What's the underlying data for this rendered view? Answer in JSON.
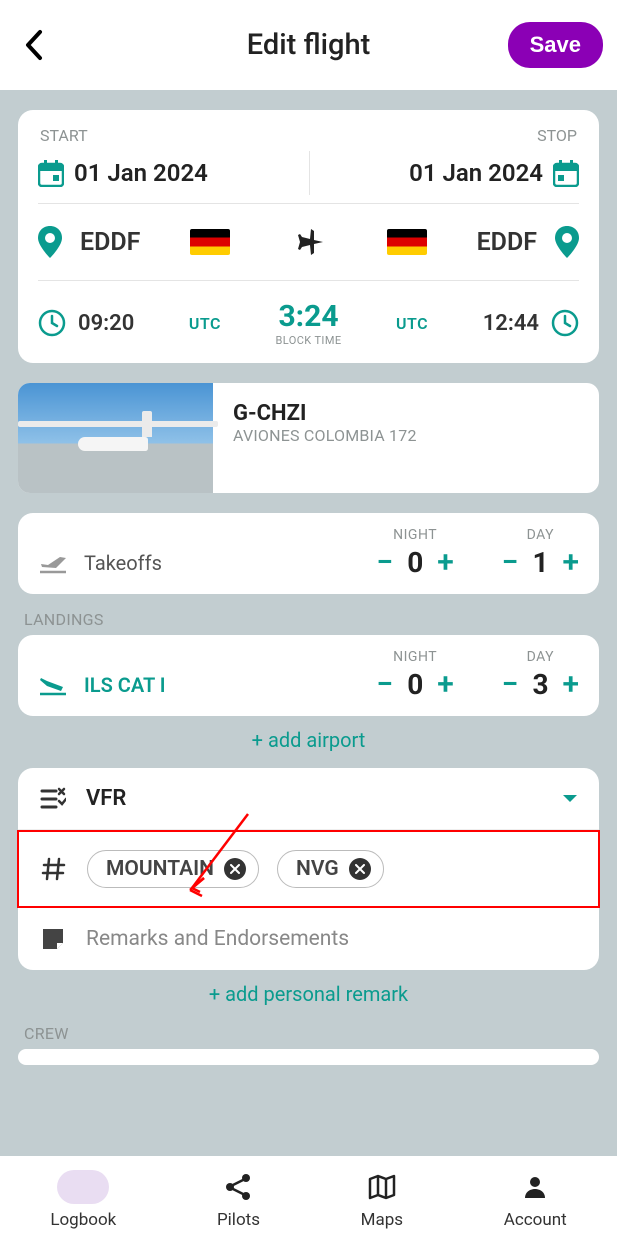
{
  "header": {
    "title": "Edit flight",
    "save": "Save"
  },
  "route": {
    "start_label": "START",
    "stop_label": "STOP",
    "start_date": "01 Jan 2024",
    "stop_date": "01 Jan 2024",
    "dep_code": "EDDF",
    "arr_code": "EDDF",
    "dep_time": "09:20",
    "arr_time": "12:44",
    "tz_left": "UTC",
    "tz_right": "UTC",
    "block_value": "3:24",
    "block_label": "BLOCK TIME"
  },
  "aircraft": {
    "reg": "G-CHZI",
    "type": "AVIONES COLOMBIA 172"
  },
  "takeoffs": {
    "label": "Takeoffs",
    "night_label": "NIGHT",
    "night": "0",
    "day_label": "DAY",
    "day": "1"
  },
  "landings_section": "LANDINGS",
  "landings": {
    "approach": "ILS CAT I",
    "night_label": "NIGHT",
    "night": "0",
    "day_label": "DAY",
    "day": "3"
  },
  "add_airport": "+ add airport",
  "rules": "VFR",
  "tags": {
    "t0": "MOUNTAIN",
    "t1": "NVG"
  },
  "remarks": "Remarks and Endorsements",
  "add_remark": "+ add personal remark",
  "crew_section": "CREW",
  "nav": {
    "logbook": "Logbook",
    "pilots": "Pilots",
    "maps": "Maps",
    "account": "Account"
  },
  "colors": {
    "accent_teal": "#0a9b8e",
    "accent_purple": "#8b00b5",
    "annotation": "#ff0000"
  }
}
